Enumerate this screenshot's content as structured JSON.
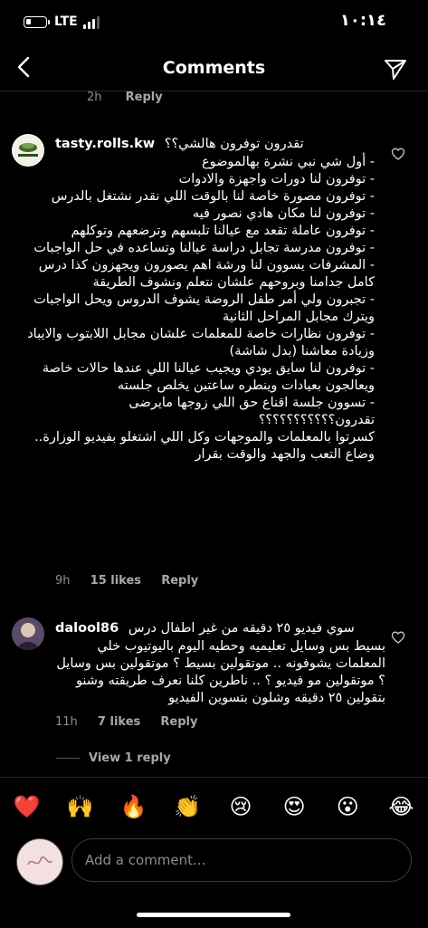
{
  "status": {
    "carrier": "LTE",
    "time": "١٠:١٤"
  },
  "header": {
    "title": "Comments"
  },
  "previous_comment": {
    "time": "2h",
    "reply": "Reply"
  },
  "comments": [
    {
      "username": "tasty.rolls.kw",
      "first_line": "تقدرون توفرون هالشي؟؟",
      "lines": [
        "- أول شي نبي نشرة بهالموضوع",
        "- توفرون لنا دورات واجهزة والادوات",
        "- توفرون مصورة خاصة لنا بالوقت اللي نقدر نشتغل بالدرس",
        "- توفرون لنا مكان هادي نصور فيه",
        "- توفرون عاملة تقعد مع عيالنا تلبسهم وترضعهم وتوكلهم",
        "- توفرون مدرسة تجابل دراسة عيالنا وتساعده في حل الواجبات",
        "- المشرفات يسوون لنا ورشة اهم يصورون ويجهزون كذا درس كامل جدامنا وبروحهم علشان نتعلم ونشوف الطريقة",
        "- تجبرون ولي أمر طفل الروضة يشوف الدروس ويحل الواجبات ويترك مجابل المراحل الثانية",
        "- توفرون نظارات خاصة للمعلمات علشان مجابل اللابتوب والايباد وزيادة معاشنا (بدل شاشة)",
        "- توفرون لنا سايق يودي ويجيب عيالنا اللي عندها حالات خاصة ويعالجون بعيادات وينطره ساعتين يخلص جلسته",
        "- تسوون جلسة اقناع حق اللي زوجها مايرضى",
        "تقدرون؟؟؟؟؟؟؟؟؟؟؟",
        "كسرتوا بالمعلمات والموجهات وكل اللي اشتغلو بفيديو الوزارة.. وضاع التعب والجهد والوقت بقرار"
      ],
      "time": "9h",
      "likes": "15 likes",
      "reply": "Reply"
    },
    {
      "username": "dalool86",
      "first_line": "سوي فيديو ٢٥ دقيقه من غير اطفال درس",
      "body": "بسيط بس وسايل تعليميه وحطيه اليوم باليوتيوب خلي المعلمات يشوفونه .. موتقولين بسيط ؟ موتقولين بس وسايل ؟ موتقولين مو فيديو ؟ .. ناطرين كلنا نعرف طريقته وشنو بتقولين ٢٥ دقيقه وشلون بتسوين الفيديو",
      "time": "11h",
      "likes": "7 likes",
      "reply": "Reply",
      "view_replies": "View 1 reply"
    }
  ],
  "emojis": [
    "❤️",
    "🙌",
    "🔥",
    "👏",
    "😢",
    "😍",
    "😮",
    "😂"
  ],
  "composer": {
    "placeholder": "Add a comment..."
  }
}
